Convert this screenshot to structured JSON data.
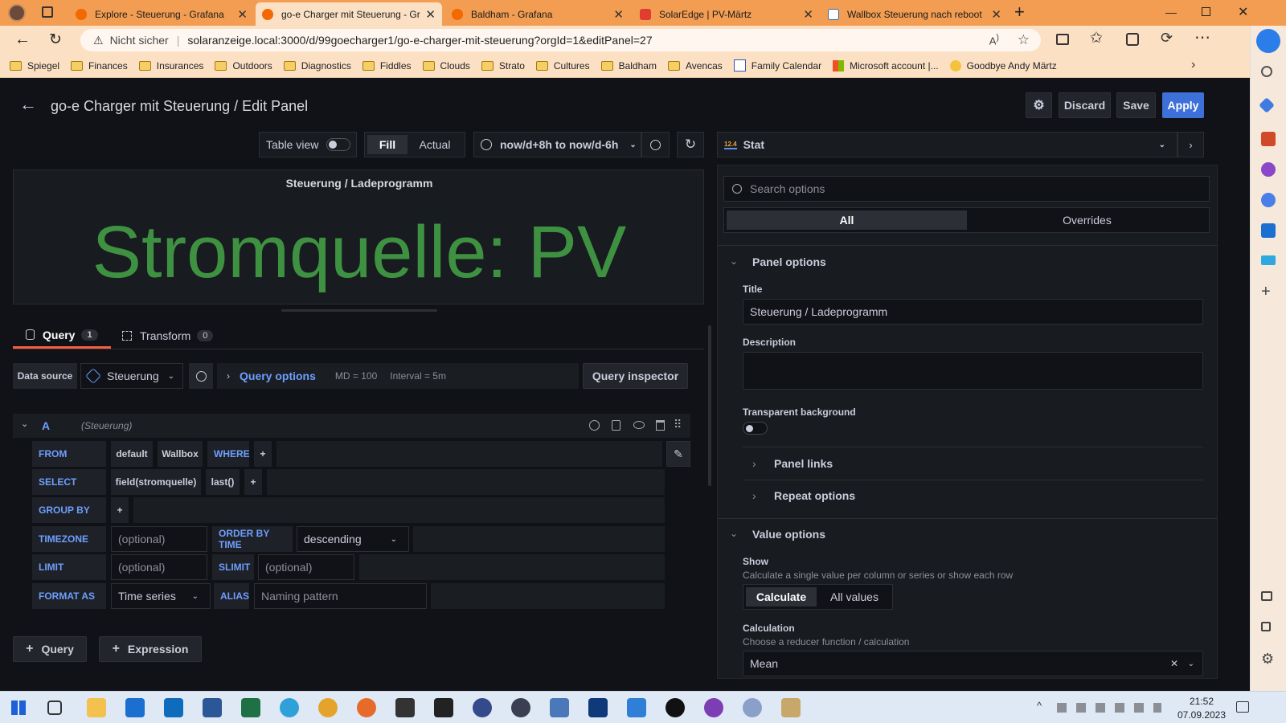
{
  "browser": {
    "tabs": [
      {
        "title": "Explore - Steuerung - Grafana",
        "color": "#f46800"
      },
      {
        "title": "go-e Charger mit Steuerung - Gr",
        "color": "#f46800"
      },
      {
        "title": "Baldham - Grafana",
        "color": "#f46800"
      },
      {
        "title": "SolarEdge | PV-Märtz",
        "color": "#e03c31"
      },
      {
        "title": "Wallbox Steuerung nach reboot",
        "color": "#2b6cb0"
      }
    ],
    "not_secure": "Nicht sicher",
    "url": "solaranzeige.local:3000/d/99goecharger1/go-e-charger-mit-steuerung?orgId=1&editPanel=27",
    "bookmarks": [
      "Spiegel",
      "Finances",
      "Insurances",
      "Outdoors",
      "Diagnostics",
      "Fiddles",
      "Clouds",
      "Strato",
      "Cultures",
      "Baldham",
      "Avencas",
      "Family Calendar",
      "Microsoft account |...",
      "Goodbye Andy Märtz"
    ]
  },
  "header": {
    "title": "go-e Charger mit Steuerung / Edit Panel",
    "discard": "Discard",
    "save": "Save",
    "apply": "Apply"
  },
  "toolbar": {
    "table_view": "Table view",
    "fill": "Fill",
    "actual": "Actual",
    "time_range": "now/d+8h to now/d-6h",
    "viz": "Stat",
    "viz_icon_text": "12.4"
  },
  "panel": {
    "title": "Steuerung / Ladeprogramm",
    "value": "Stromquelle: PV",
    "value_color": "#3f9142"
  },
  "query_tabs": {
    "query": "Query",
    "query_count": "1",
    "transform": "Transform",
    "transform_count": "0"
  },
  "datasource": {
    "label": "Data source",
    "name": "Steuerung",
    "query_options": "Query options",
    "md": "MD = 100",
    "interval": "Interval = 5m",
    "inspector": "Query inspector"
  },
  "query": {
    "ref": "A",
    "ds": "(Steuerung)",
    "from": "FROM",
    "from_db": "default",
    "from_meas": "Wallbox",
    "where": "WHERE",
    "plus": "+",
    "select": "SELECT",
    "field": "field(stromquelle)",
    "fn": "last()",
    "group_by": "GROUP BY",
    "timezone": "TIMEZONE",
    "optional": "(optional)",
    "order_by": "ORDER BY TIME",
    "order_val": "descending",
    "limit": "LIMIT",
    "slimit": "SLIMIT",
    "format_as": "FORMAT AS",
    "format_val": "Time series",
    "alias": "ALIAS",
    "alias_ph": "Naming pattern"
  },
  "add": {
    "query": "Query",
    "expression": "Expression"
  },
  "options": {
    "search_ph": "Search options",
    "all": "All",
    "overrides": "Overrides",
    "panel_options": "Panel options",
    "title_label": "Title",
    "title_val": "Steuerung / Ladeprogramm",
    "description": "Description",
    "transparent": "Transparent background",
    "panel_links": "Panel links",
    "repeat": "Repeat options",
    "value_options": "Value options",
    "show": "Show",
    "show_desc": "Calculate a single value per column or series or show each row",
    "calculate": "Calculate",
    "all_values": "All values",
    "calculation": "Calculation",
    "calc_desc": "Choose a reducer function / calculation",
    "calc_val": "Mean"
  },
  "taskbar": {
    "time": "21:52",
    "date": "07.09.2023"
  }
}
